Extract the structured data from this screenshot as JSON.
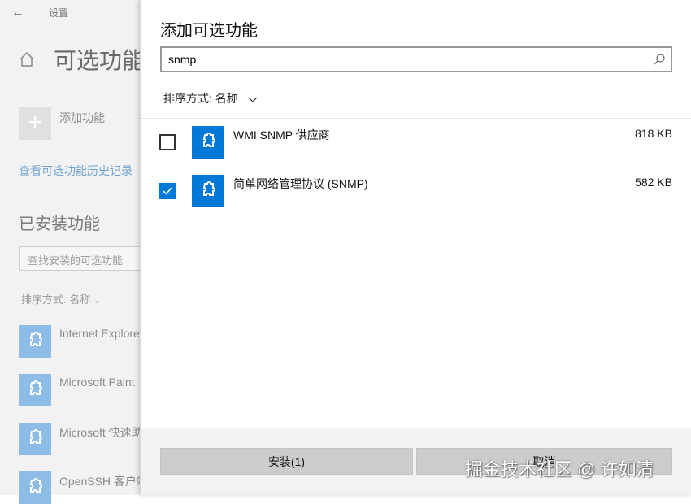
{
  "background_page": {
    "app_title": "设置",
    "page_title": "可选功能",
    "add_feature_label": "添加功能",
    "history_link": "查看可选功能历史记录",
    "installed_heading": "已安装功能",
    "installed_search_placeholder": "查找安装的可选功能",
    "sort_label": "排序方式: 名称",
    "installed_features": [
      {
        "name": "Internet Explorer"
      },
      {
        "name": "Microsoft Paint"
      },
      {
        "name": "Microsoft 快速助手"
      },
      {
        "name": "OpenSSH 客户端"
      }
    ]
  },
  "dialog": {
    "title": "添加可选功能",
    "search": {
      "value": "snmp",
      "icon": "search-icon"
    },
    "sort_label": "排序方式: 名称",
    "results": [
      {
        "name": "WMI SNMP 供应商",
        "size": "818 KB",
        "checked": false,
        "icon": "puzzle-icon"
      },
      {
        "name": "简单网络管理协议 (SNMP)",
        "size": "582 KB",
        "checked": true,
        "icon": "puzzle-icon"
      }
    ],
    "install_label": "安装(1)",
    "cancel_label": "取消"
  },
  "watermark": "掘金技术社区 @ 许如清",
  "colors": {
    "accent": "#0078d7",
    "accent_light": "#8dbde6",
    "footer_bg": "#f2f2f2",
    "button_bg": "#cccccc"
  }
}
